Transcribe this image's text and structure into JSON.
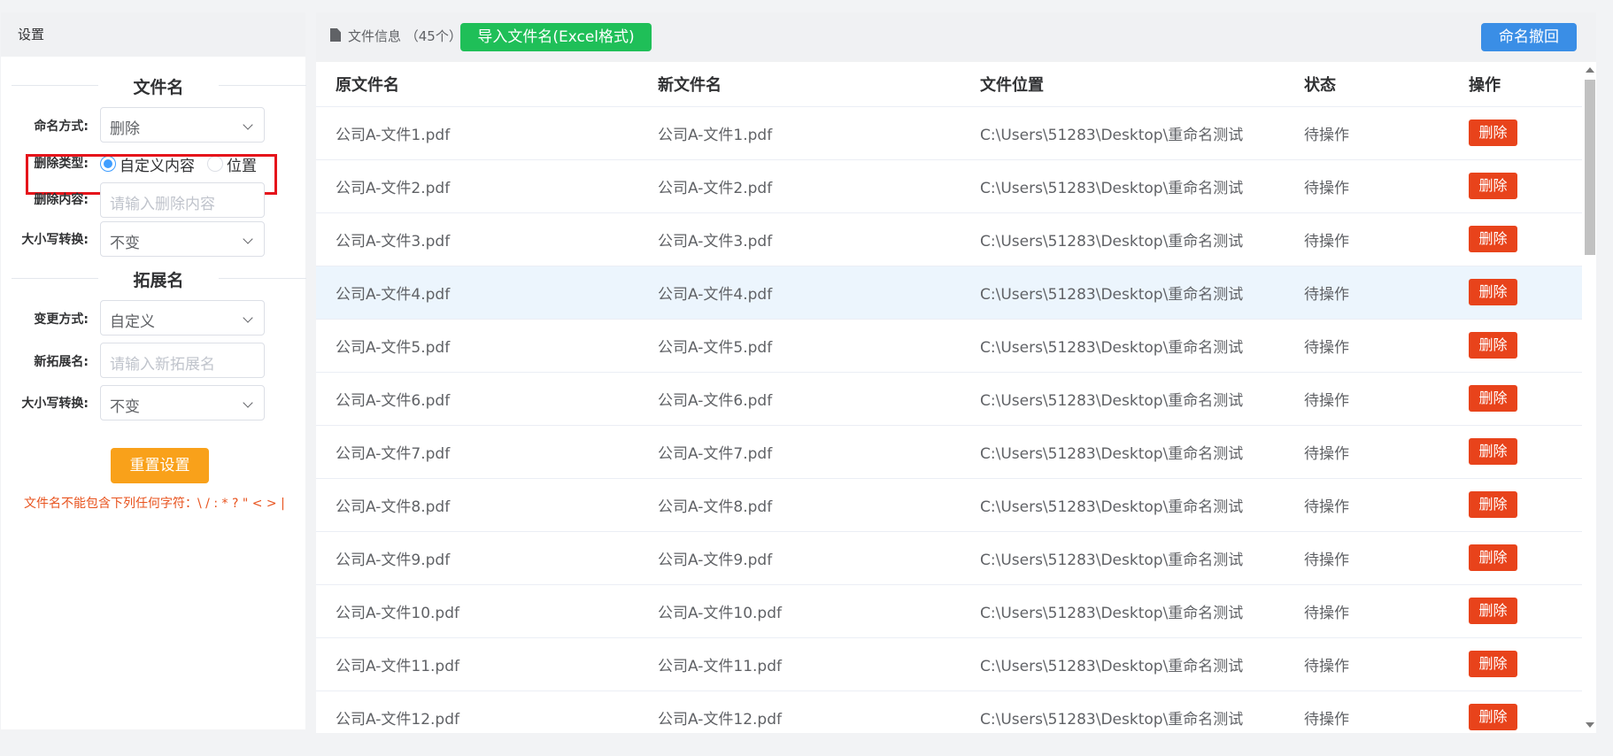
{
  "left": {
    "header": "设置",
    "filename_section": "文件名",
    "naming_mode_label": "命名方式:",
    "naming_mode_value": "删除",
    "delete_type_label": "删除类型:",
    "delete_type_options": [
      "自定义内容",
      "位置"
    ],
    "delete_type_selected": "自定义内容",
    "delete_content_label": "删除内容:",
    "delete_content_placeholder": "请输入删除内容",
    "case_label": "大小写转换:",
    "case_value": "不变",
    "ext_section": "拓展名",
    "change_mode_label": "变更方式:",
    "change_mode_value": "自定义",
    "new_ext_label": "新拓展名:",
    "new_ext_placeholder": "请输入新拓展名",
    "ext_case_label": "大小写转换:",
    "ext_case_value": "不变",
    "reset_label": "重置设置",
    "warning": "文件名不能包含下列任何字符：\\ / : * ? \" < > |"
  },
  "right": {
    "header_info": "文件信息 （45个）",
    "import_label": "导入文件名(Excel格式)",
    "undo_label": "命名撤回",
    "columns": [
      "原文件名",
      "新文件名",
      "文件位置",
      "状态",
      "操作"
    ],
    "delete_label": "删除",
    "highlight_color": "#ecf5fd",
    "rows": [
      {
        "orig": "公司A-文件1.pdf",
        "new": "公司A-文件1.pdf",
        "loc": "C:\\Users\\51283\\Desktop\\重命名测试",
        "status": "待操作"
      },
      {
        "orig": "公司A-文件2.pdf",
        "new": "公司A-文件2.pdf",
        "loc": "C:\\Users\\51283\\Desktop\\重命名测试",
        "status": "待操作"
      },
      {
        "orig": "公司A-文件3.pdf",
        "new": "公司A-文件3.pdf",
        "loc": "C:\\Users\\51283\\Desktop\\重命名测试",
        "status": "待操作"
      },
      {
        "orig": "公司A-文件4.pdf",
        "new": "公司A-文件4.pdf",
        "loc": "C:\\Users\\51283\\Desktop\\重命名测试",
        "status": "待操作",
        "highlight": true
      },
      {
        "orig": "公司A-文件5.pdf",
        "new": "公司A-文件5.pdf",
        "loc": "C:\\Users\\51283\\Desktop\\重命名测试",
        "status": "待操作"
      },
      {
        "orig": "公司A-文件6.pdf",
        "new": "公司A-文件6.pdf",
        "loc": "C:\\Users\\51283\\Desktop\\重命名测试",
        "status": "待操作"
      },
      {
        "orig": "公司A-文件7.pdf",
        "new": "公司A-文件7.pdf",
        "loc": "C:\\Users\\51283\\Desktop\\重命名测试",
        "status": "待操作"
      },
      {
        "orig": "公司A-文件8.pdf",
        "new": "公司A-文件8.pdf",
        "loc": "C:\\Users\\51283\\Desktop\\重命名测试",
        "status": "待操作"
      },
      {
        "orig": "公司A-文件9.pdf",
        "new": "公司A-文件9.pdf",
        "loc": "C:\\Users\\51283\\Desktop\\重命名测试",
        "status": "待操作"
      },
      {
        "orig": "公司A-文件10.pdf",
        "new": "公司A-文件10.pdf",
        "loc": "C:\\Users\\51283\\Desktop\\重命名测试",
        "status": "待操作"
      },
      {
        "orig": "公司A-文件11.pdf",
        "new": "公司A-文件11.pdf",
        "loc": "C:\\Users\\51283\\Desktop\\重命名测试",
        "status": "待操作"
      },
      {
        "orig": "公司A-文件12.pdf",
        "new": "公司A-文件12.pdf",
        "loc": "C:\\Users\\51283\\Desktop\\重命名测试",
        "status": "待操作"
      }
    ]
  }
}
